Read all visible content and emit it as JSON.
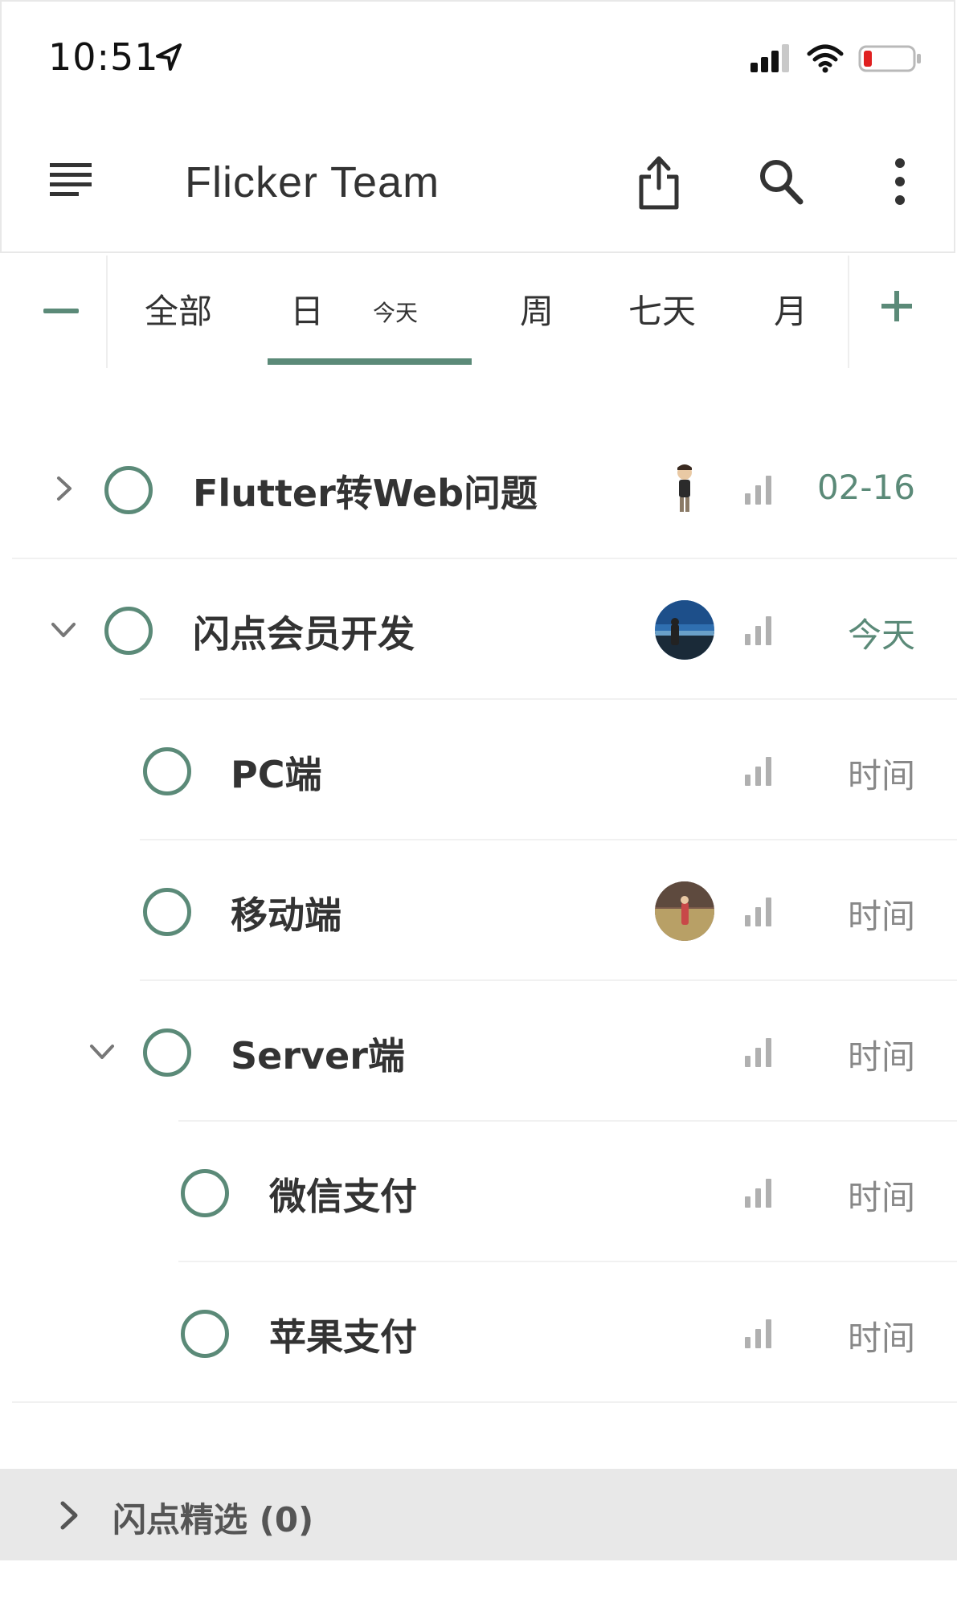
{
  "status_bar": {
    "time": "10:51",
    "battery_color": "#e02020"
  },
  "app_bar": {
    "title": "Flicker Team",
    "icons": [
      "menu-icon",
      "share-icon",
      "search-icon",
      "more-vertical-icon"
    ]
  },
  "tabs": {
    "items": [
      {
        "label": "全部"
      },
      {
        "label": "日",
        "sub": "今天",
        "selected": true
      },
      {
        "label": "周"
      },
      {
        "label": "七天"
      },
      {
        "label": "月"
      }
    ],
    "accent": "#5b8a78"
  },
  "tasks": [
    {
      "title": "Flutter转Web问题",
      "time": "02-16",
      "time_highlight": true,
      "expander": "collapsed",
      "avatar": "person-avatar",
      "level": 0
    },
    {
      "title": "闪点会员开发",
      "time": "今天",
      "time_highlight": true,
      "expander": "expanded",
      "avatar": "landscape-avatar",
      "level": 0
    },
    {
      "title": "PC端",
      "time": "时间",
      "level": 1
    },
    {
      "title": "移动端",
      "time": "时间",
      "avatar": "outdoor-avatar",
      "level": 1
    },
    {
      "title": "Server端",
      "time": "时间",
      "expander": "expanded",
      "level": 1
    },
    {
      "title": "微信支付",
      "time": "时间",
      "level": 2
    },
    {
      "title": "苹果支付",
      "time": "时间",
      "level": 2
    }
  ],
  "group": {
    "label": "闪点精选 (0)"
  }
}
